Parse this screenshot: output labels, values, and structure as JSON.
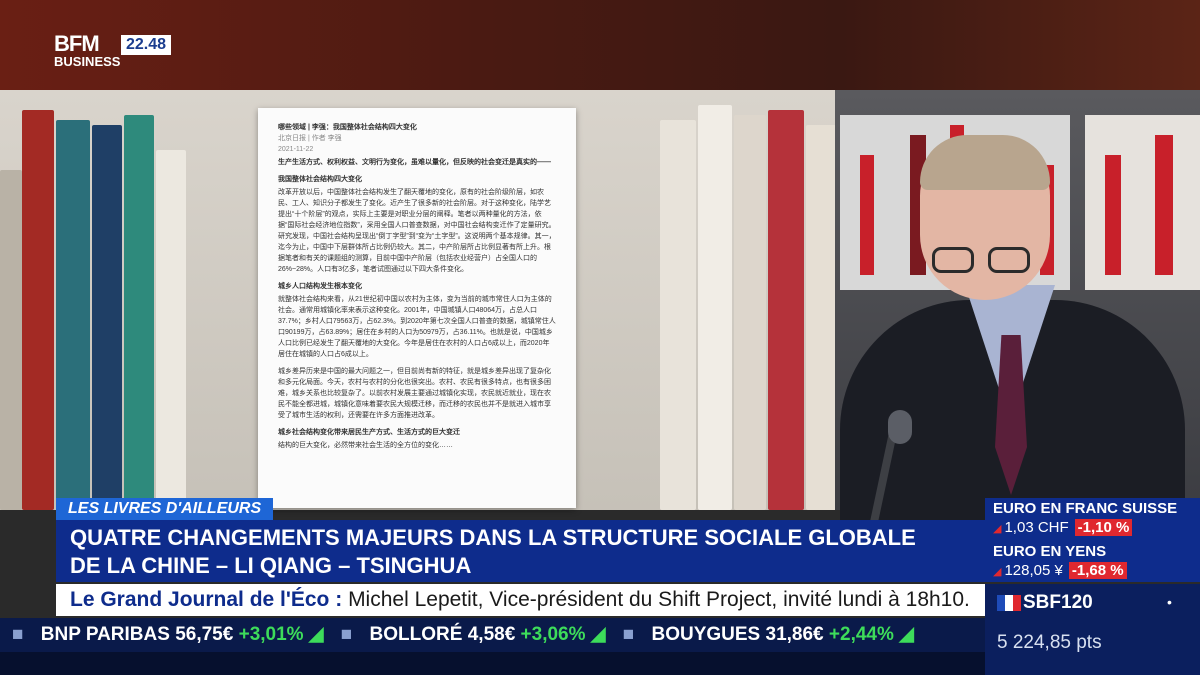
{
  "channel": {
    "logo_top": "BFM",
    "logo_bottom": "BUSINESS",
    "time": "22.48"
  },
  "document": {
    "header": "哪些领域 | 李强：我国整体社会结构四大变化",
    "meta_line1": "北京日报 | 作者 李强",
    "meta_line2": "2021-11-22",
    "intro": "生产生活方式、权利权益、文明行为变化，虽难以量化，但反映的社会变迁是真实的——",
    "heading1": "我国整体社会结构四大变化",
    "para1": "改革开放以后，中国整体社会结构发生了翻天覆地的变化，原有的社会阶级阶层，如农民、工人、知识分子都发生了变化。近产生了很多新的社会阶层。对于这种变化，陆学艺提出“十个阶层”的观点，实际上主要是对职业分层的阐释。笔者以两种量化的方法，依据“国际社会经济地位指数”，采用全国人口普查数据，对中国社会结构变迁作了定量研究。研究发现，中国社会结构呈现出“倒丁字型”到“变为“土字型”。这说明两个基本规律。其一，迄今为止，中国中下层群体所占比例仍较大。其二，中产阶层所占比例显著有所上升。根据笔者和有关的课题组的测算，目前中国中产阶层（包括农业经营户）占全国人口的26%~28%。人口有3亿多，笔者试图通过以下四大条件变化。",
    "heading2": "城乡人口结构发生根本变化",
    "para2": "就整体社会结构来看，从21世纪初中国以农村为主体，变为当前的城市常住人口为主体的社会。通常用城镇化率来表示这种变化。2001年，中国城镇人口48064万，占总人口37.7%；乡村人口79563万，占62.3%。到2020年第七次全国人口普查的数据，城镇常住人口90199万，占63.89%；居住在乡村的人口为50979万，占36.11%。也就是说，中国城乡人口比例已经发生了翻天覆地的大变化。今年是居住在农村的人口占6成以上，而2020年居住在城镇的人口占6成以上。",
    "para3": "城乡差异历来是中国的最大问题之一，但目前尚有新的特征，就是城乡差异出现了复杂化和多元化局面。今天，农村与农村的分化也很突出。农村、农民有很多特点，也有很多困难，城乡关系也比较复杂了。以前农村发展主要通过城镇化实现，农民就近就业，现在农民不能全都进城，城镇化意味着要农民大规模迁移，而迁移的农民也并不是就进入城市享受了城市生活的权利，还需要在许多方面推进改革。",
    "heading3": "城乡社会结构变化带来居民生产方式、生活方式的巨大变迁",
    "para4": "结构的巨大变化，必然带来社会生活的全方位的变化……"
  },
  "lower_third": {
    "section": "LES LIVRES D'AILLEURS",
    "headline_line1": "QUATRE CHANGEMENTS MAJEURS DANS LA STRUCTURE SOCIALE GLOBALE",
    "headline_line2": "DE LA CHINE – LI QIANG – TSINGHUA",
    "journal_label": "Le Grand Journal de l'Éco :",
    "journal_text": "Michel Lepetit, Vice-président du Shift Project, invité lundi à 18h10."
  },
  "ticker": [
    {
      "name": "BNP PARIBAS",
      "price": "56,75€",
      "change": "+3,01%"
    },
    {
      "name": "BOLLORÉ",
      "price": "4,58€",
      "change": "+3,06%"
    },
    {
      "name": "BOUYGUES",
      "price": "31,86€",
      "change": "+2,44%"
    }
  ],
  "fx": [
    {
      "title": "EURO EN FRANC SUISSE",
      "value": "1,03 CHF",
      "change": "-1,10 %"
    },
    {
      "title": "EURO EN YENS",
      "value": "128,05 ¥",
      "change": "-1,68 %"
    }
  ],
  "index": {
    "name": "SBF120",
    "value": "5 224,85 pts"
  },
  "colors": {
    "brand_blue": "#0e2c8c",
    "tag_blue": "#1e66d6",
    "positive": "#3ddc5a",
    "negative": "#e0282f"
  }
}
